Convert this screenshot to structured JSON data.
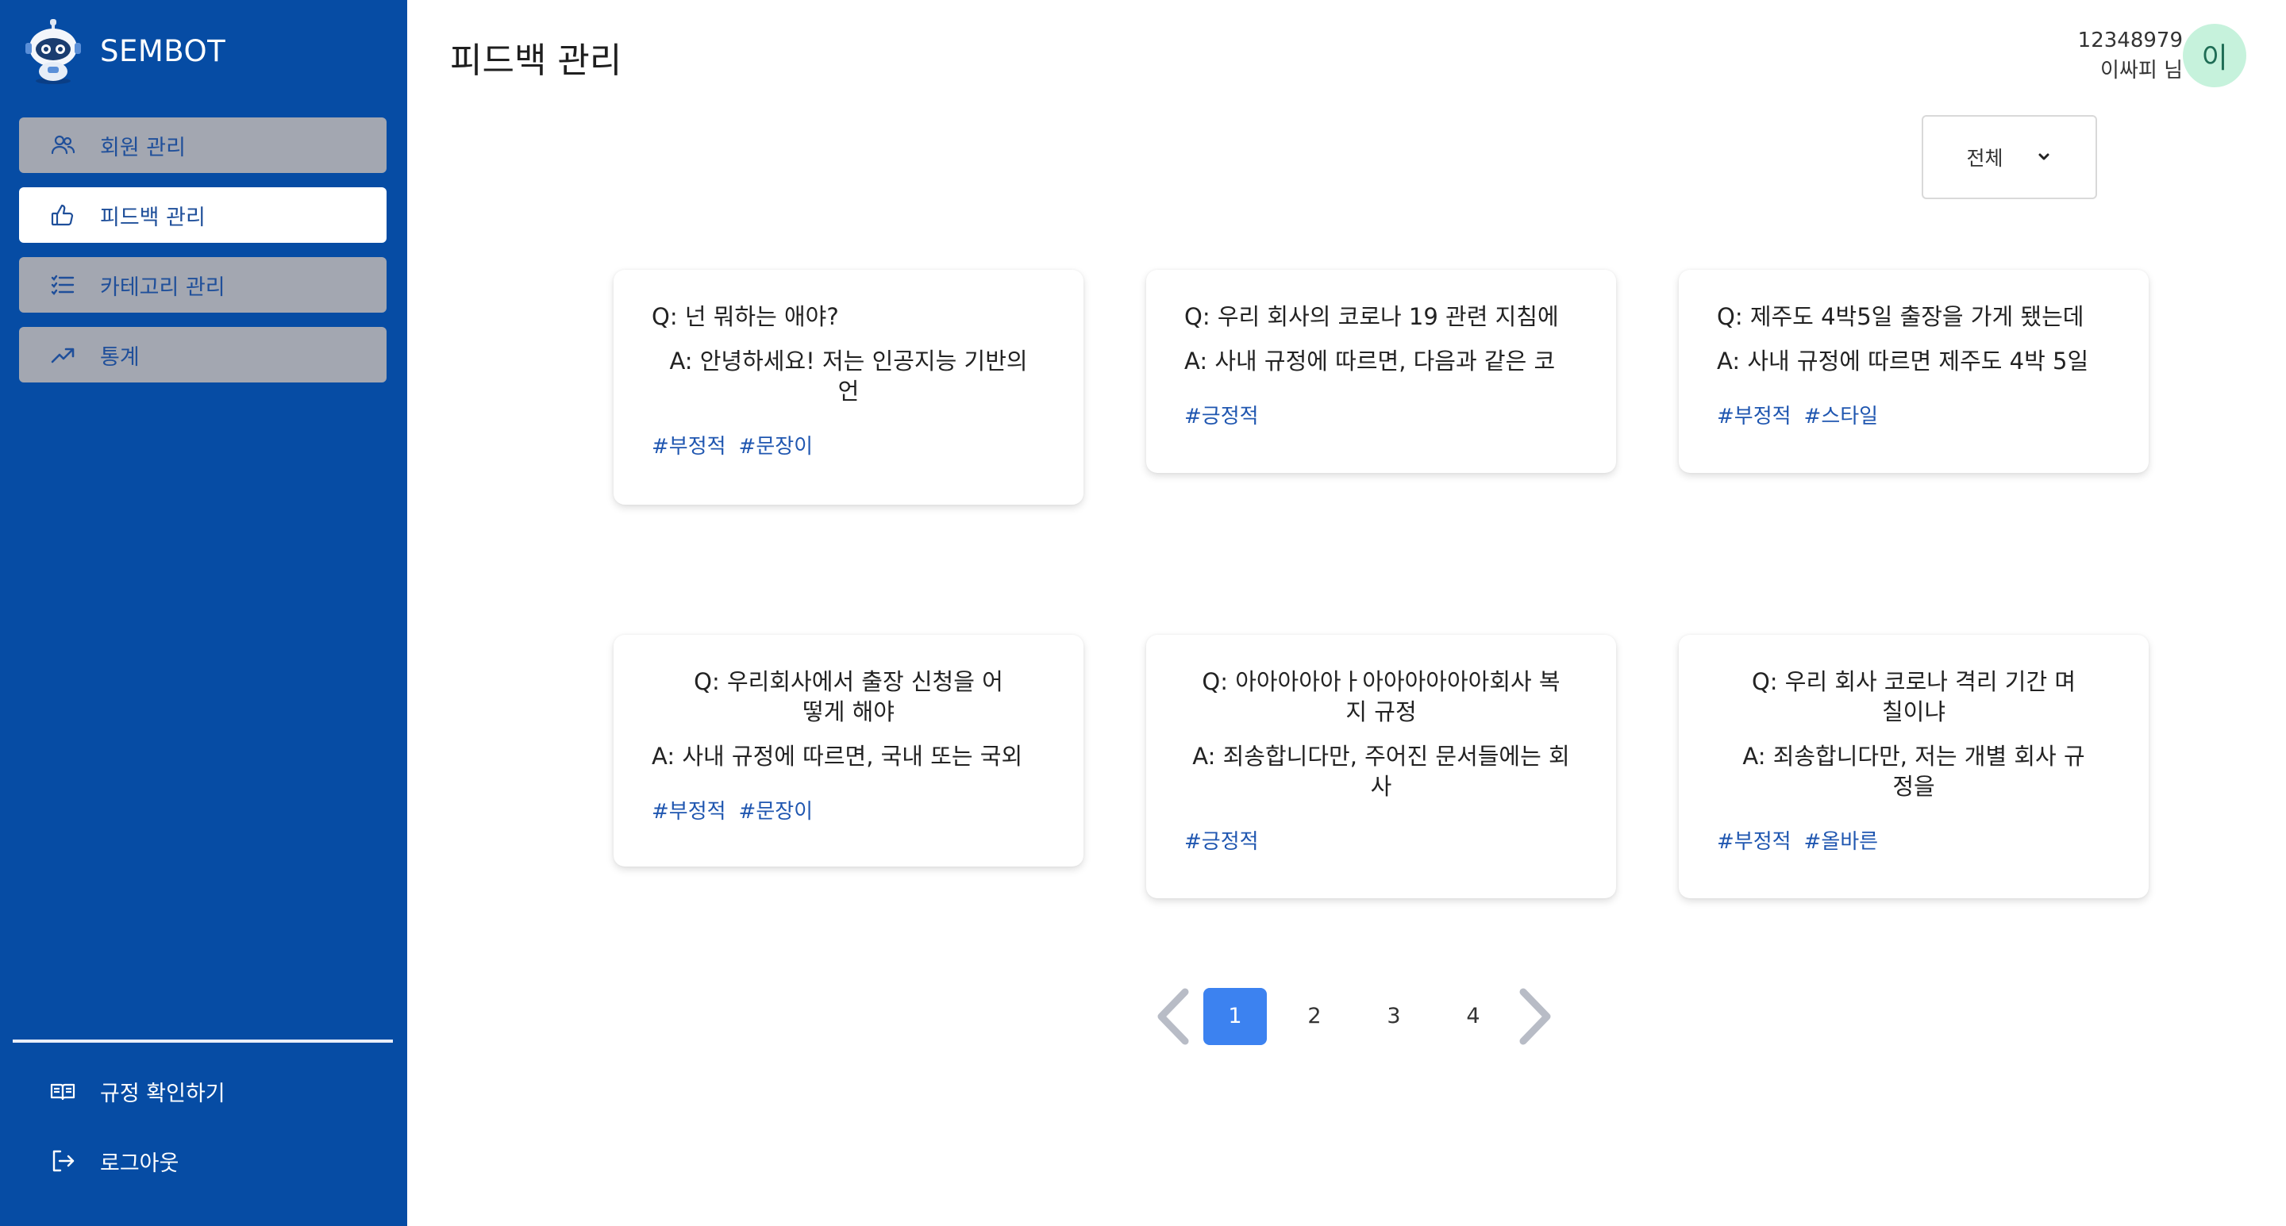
{
  "brand": {
    "name": "SEMBOT"
  },
  "sidebar": {
    "items": [
      {
        "label": "회원 관리",
        "icon": "users-icon",
        "active": false
      },
      {
        "label": "피드백 관리",
        "icon": "thumbs-up-icon",
        "active": true
      },
      {
        "label": "카테고리 관리",
        "icon": "list-icon",
        "active": false
      },
      {
        "label": "통계",
        "icon": "trend-up-icon",
        "active": false
      }
    ],
    "bottom_items": [
      {
        "label": "규정 확인하기",
        "icon": "book-icon"
      },
      {
        "label": "로그아웃",
        "icon": "logout-icon"
      }
    ]
  },
  "header": {
    "title": "피드백 관리",
    "user_id": "12348979",
    "user_name": "이싸피 님",
    "avatar_initial": "이"
  },
  "filter": {
    "selected": "전체"
  },
  "cards": [
    {
      "q": "Q: 넌 뭐하는 애야?",
      "a": "A: 안녕하세요! 저는 인공지능 기반의 언",
      "tags": [
        "#부정적",
        "#문장이"
      ]
    },
    {
      "q": "Q: 우리 회사의 코로나 19 관련 지침에",
      "a": "A: 사내 규정에 따르면, 다음과 같은 코",
      "tags": [
        "#긍정적"
      ]
    },
    {
      "q": "Q: 제주도 4박5일 출장을 가게 됐는데",
      "a": "A: 사내 규정에 따르면 제주도 4박 5일",
      "tags": [
        "#부정적",
        "#스타일"
      ]
    },
    {
      "q": "Q: 우리회사에서 출장 신청을 어떻게 해야",
      "a": "A: 사내 규정에 따르면, 국내 또는 국외",
      "tags": [
        "#부정적",
        "#문장이"
      ]
    },
    {
      "q": "Q: 아아아아아ㅏ아아아아아아회사 복지 규정",
      "a": "A: 죄송합니다만, 주어진 문서들에는 회사",
      "tags": [
        "#긍정적"
      ]
    },
    {
      "q": "Q: 우리 회사 코로나 격리 기간 며칠이냐",
      "a": "A: 죄송합니다만, 저는 개별 회사 규정을",
      "tags": [
        "#부정적",
        "#올바른"
      ]
    }
  ],
  "pagination": {
    "pages": [
      "1",
      "2",
      "3",
      "4"
    ],
    "current": "1"
  },
  "colors": {
    "sidebar": "#064ca4",
    "active_page": "#3c82f0",
    "tag": "#1f56b0",
    "avatar_bg": "#c6f2dc"
  }
}
